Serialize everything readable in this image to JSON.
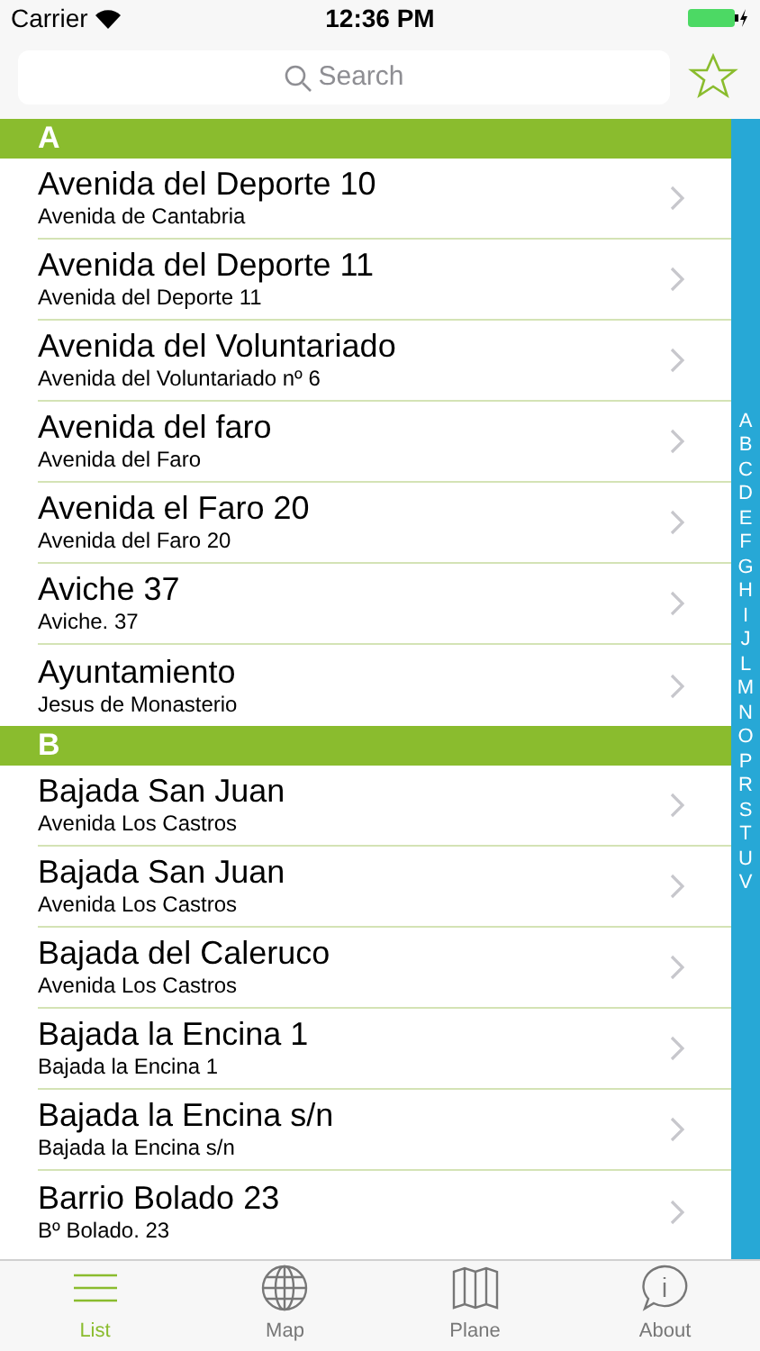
{
  "status_bar": {
    "carrier": "Carrier",
    "time": "12:36 PM"
  },
  "search": {
    "placeholder": "Search"
  },
  "sections": [
    {
      "letter": "A",
      "rows": [
        {
          "title": "Avenida del Deporte 10",
          "subtitle": "Avenida de Cantabria"
        },
        {
          "title": "Avenida del Deporte 11",
          "subtitle": "Avenida del Deporte 11"
        },
        {
          "title": "Avenida del Voluntariado",
          "subtitle": "Avenida del Voluntariado nº 6"
        },
        {
          "title": "Avenida del faro",
          "subtitle": "Avenida del Faro"
        },
        {
          "title": "Avenida el Faro 20",
          "subtitle": "Avenida del Faro 20"
        },
        {
          "title": "Aviche 37",
          "subtitle": "Aviche. 37"
        },
        {
          "title": "Ayuntamiento",
          "subtitle": "Jesus de Monasterio"
        }
      ]
    },
    {
      "letter": "B",
      "rows": [
        {
          "title": "Bajada San Juan",
          "subtitle": "Avenida Los Castros"
        },
        {
          "title": "Bajada San Juan",
          "subtitle": "Avenida Los Castros"
        },
        {
          "title": "Bajada del Caleruco",
          "subtitle": "Avenida Los Castros"
        },
        {
          "title": "Bajada la Encina 1",
          "subtitle": "Bajada la Encina 1"
        },
        {
          "title": "Bajada la Encina s/n",
          "subtitle": "Bajada la Encina s/n"
        },
        {
          "title": "Barrio Bolado 23",
          "subtitle": "Bº Bolado. 23"
        }
      ]
    }
  ],
  "index": [
    "A",
    "B",
    "C",
    "D",
    "E",
    "F",
    "G",
    "H",
    "I",
    "J",
    "L",
    "M",
    "N",
    "O",
    "P",
    "R",
    "S",
    "T",
    "U",
    "V"
  ],
  "tabs": [
    {
      "label": "List",
      "kind": "list",
      "selected": true
    },
    {
      "label": "Map",
      "kind": "globe",
      "selected": false
    },
    {
      "label": "Plane",
      "kind": "map",
      "selected": false
    },
    {
      "label": "About",
      "kind": "info",
      "selected": false
    }
  ]
}
